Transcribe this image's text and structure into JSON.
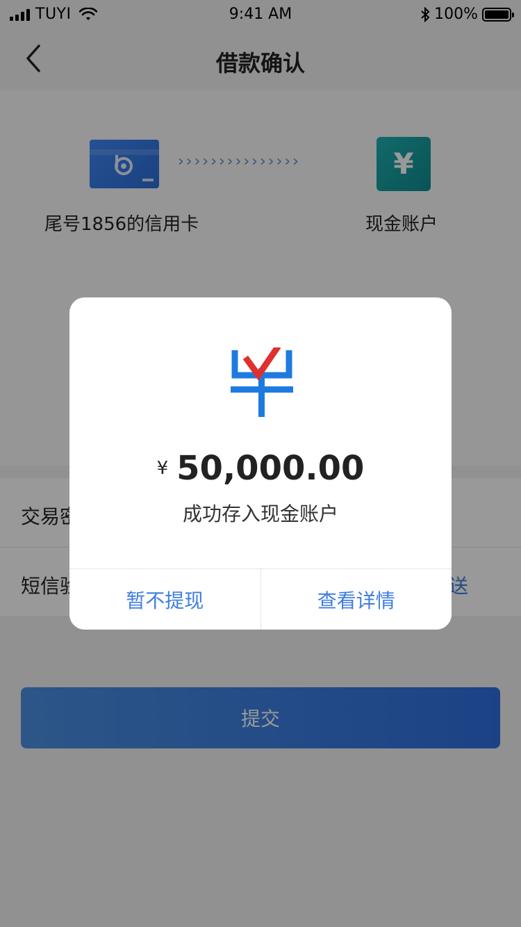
{
  "status_bar": {
    "carrier": "TUYI",
    "time": "9:41 AM",
    "battery": "100%"
  },
  "nav": {
    "title": "借款确认"
  },
  "transfer": {
    "from_label": "尾号1856的信用卡",
    "arrows": "›››››››››››››››",
    "to_symbol": "¥",
    "to_label": "现金账户"
  },
  "form": {
    "row1_label": "交易密码",
    "row2_label": "短信验证",
    "send_label": "发送"
  },
  "submit_label": "提交",
  "dialog": {
    "currency": "¥",
    "amount": "50,000.00",
    "message": "成功存入现金账户",
    "cancel_label": "暂不提现",
    "detail_label": "查看详情"
  },
  "colors": {
    "accent": "#3e7ee0",
    "check": "#e0302d",
    "cash": "#118b8f"
  }
}
